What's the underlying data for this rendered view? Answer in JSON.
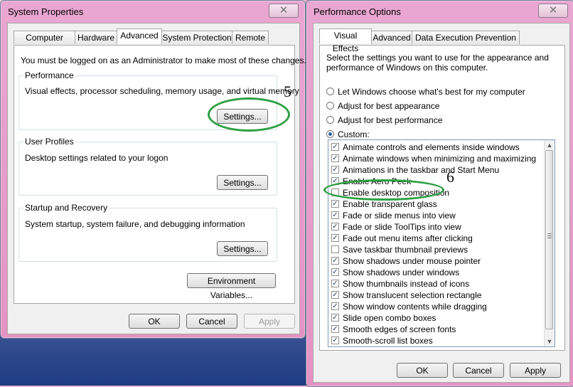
{
  "colors": {
    "annotation": "#2da043",
    "selection": "#2e5f9e"
  },
  "system": {
    "title": "System Properties",
    "close": "✕",
    "tabs": [
      "Computer Name",
      "Hardware",
      "Advanced",
      "System Protection",
      "Remote"
    ],
    "admin_note": "You must be logged on as an Administrator to make most of these changes.",
    "performance": {
      "title": "Performance",
      "description": "Visual effects, processor scheduling, memory usage, and virtual memory",
      "button": "Settings..."
    },
    "profiles": {
      "title": "User Profiles",
      "description": "Desktop settings related to your logon",
      "button": "Settings..."
    },
    "startup": {
      "title": "Startup and Recovery",
      "description": "System startup, system failure, and debugging information",
      "button": "Settings..."
    },
    "environment_button": "Environment Variables...",
    "ok": "OK",
    "cancel": "Cancel",
    "apply": "Apply"
  },
  "performance_options": {
    "title": "Performance Options",
    "close": "✕",
    "tabs": [
      "Visual Effects",
      "Advanced",
      "Data Execution Prevention"
    ],
    "intro": "Select the settings you want to use for the appearance and performance of Windows on this computer.",
    "radios": [
      {
        "label": "Let Windows choose what's best for my computer",
        "checked": false
      },
      {
        "label": "Adjust for best appearance",
        "checked": false
      },
      {
        "label": "Adjust for best performance",
        "checked": false
      },
      {
        "label": "Custom:",
        "checked": true
      }
    ],
    "effects": [
      {
        "label": "Animate controls and elements inside windows",
        "checked": true
      },
      {
        "label": "Animate windows when minimizing and maximizing",
        "checked": true
      },
      {
        "label": "Animations in the taskbar and Start Menu",
        "checked": true
      },
      {
        "label": "Enable Aero Peek",
        "checked": true
      },
      {
        "label": "Enable desktop composition",
        "checked": false
      },
      {
        "label": "Enable transparent glass",
        "checked": true
      },
      {
        "label": "Fade or slide menus into view",
        "checked": true
      },
      {
        "label": "Fade or slide ToolTips into view",
        "checked": true
      },
      {
        "label": "Fade out menu items after clicking",
        "checked": true
      },
      {
        "label": "Save taskbar thumbnail previews",
        "checked": false
      },
      {
        "label": "Show shadows under mouse pointer",
        "checked": true
      },
      {
        "label": "Show shadows under windows",
        "checked": true
      },
      {
        "label": "Show thumbnails instead of icons",
        "checked": true
      },
      {
        "label": "Show translucent selection rectangle",
        "checked": true
      },
      {
        "label": "Show window contents while dragging",
        "checked": true
      },
      {
        "label": "Slide open combo boxes",
        "checked": true
      },
      {
        "label": "Smooth edges of screen fonts",
        "checked": true
      },
      {
        "label": "Smooth-scroll list boxes",
        "checked": true
      }
    ],
    "scroll_up": "▲",
    "scroll_down": "▼",
    "ok": "OK",
    "cancel": "Cancel",
    "apply": "Apply"
  },
  "annotations": {
    "five": "5",
    "six": "6"
  }
}
